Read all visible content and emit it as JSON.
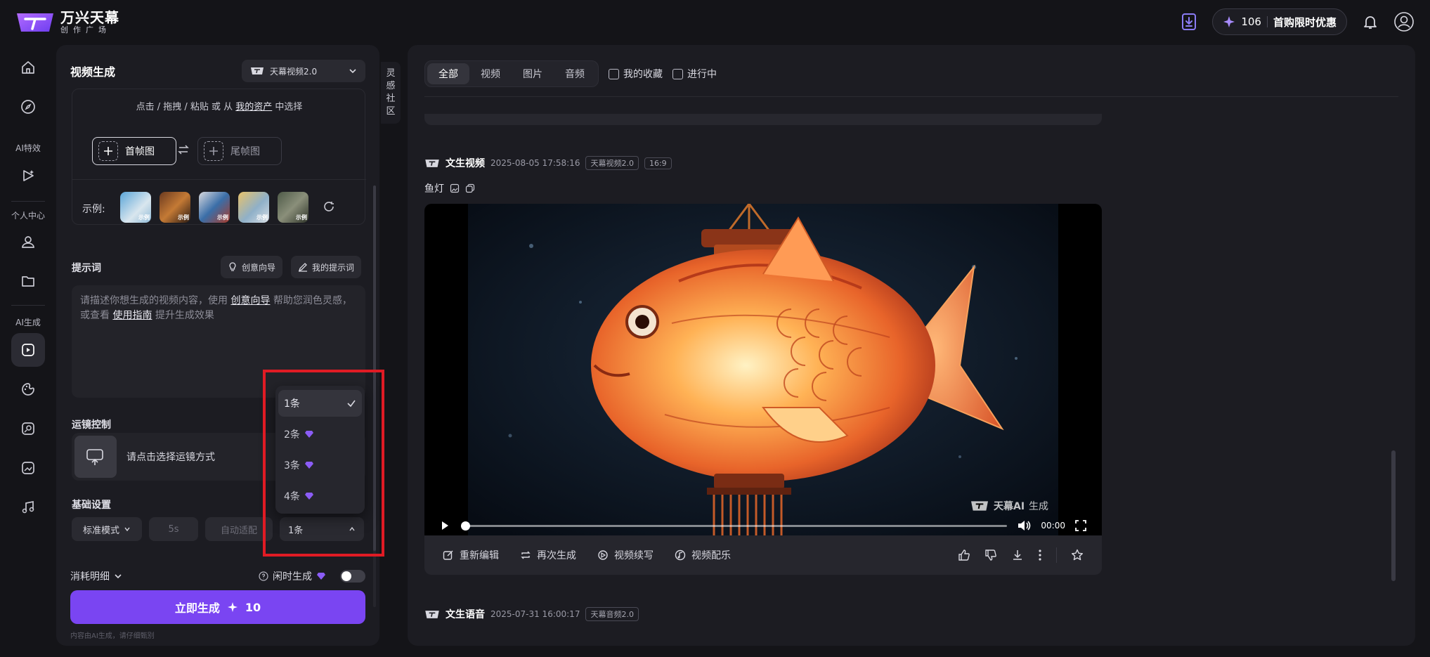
{
  "app": {
    "title": "万兴天幕",
    "subtitle": "创作广场"
  },
  "topbar": {
    "credits": "106",
    "promo": "首购限时优惠"
  },
  "rail": {
    "sections": [
      {
        "label": "AI特效"
      },
      {
        "label": "个人中心"
      },
      {
        "label": "AI生成"
      }
    ]
  },
  "panel": {
    "title": "视频生成",
    "model": "天幕视频2.0",
    "upload_hint_prefix": "点击 / 拖拽 / 粘贴  或 从 ",
    "upload_hint_link": "我的资产",
    "upload_hint_suffix": " 中选择",
    "first_frame": "首帧图",
    "last_frame": "尾帧图",
    "examples_label": "示例:",
    "example_tag": "示例",
    "prompt_label": "提示词",
    "creative_guide_btn": "创意向导",
    "my_prompts_btn": "我的提示词",
    "prompt_placeholder_1": "请描述你想生成的视频内容，使用 ",
    "prompt_placeholder_link1": "创意向导",
    "prompt_placeholder_2": " 帮助您润色灵感，",
    "prompt_placeholder_3": "或查看 ",
    "prompt_placeholder_link2": "使用指南",
    "prompt_placeholder_4": " 提升生成效果",
    "camera_label": "运镜控制",
    "camera_placeholder": "请点击选择运镜方式",
    "basic_label": "基础设置",
    "mode": "标准模式",
    "duration": "5s",
    "ratio": "自动适配",
    "count": "1条",
    "cost_detail": "消耗明细",
    "idle_generate": "闲时生成",
    "generate_label": "立即生成",
    "generate_cost": "10",
    "disclaimer": "内容由AI生成，请仔细甄别"
  },
  "dropdown": {
    "options": [
      {
        "label": "1条",
        "selected": true
      },
      {
        "label": "2条",
        "premium": true
      },
      {
        "label": "3条",
        "premium": true
      },
      {
        "label": "4条",
        "premium": true
      }
    ]
  },
  "inspiration_tab": [
    "灵",
    "感",
    "社",
    "区"
  ],
  "main": {
    "tabs": [
      "全部",
      "视频",
      "图片",
      "音频"
    ],
    "active_tab": "全部",
    "checks": [
      "我的收藏",
      "进行中"
    ],
    "item1": {
      "title": "文生视频",
      "time": "2025-08-05 17:58:16",
      "tags": [
        "天幕视频2.0",
        "16:9"
      ],
      "prompt": "鱼灯",
      "watermark_brand": "天幕AI",
      "watermark_suffix": "生成",
      "video_time": "00:00",
      "actions": [
        "重新编辑",
        "再次生成",
        "视频续写",
        "视频配乐"
      ]
    },
    "item2": {
      "title": "文生语音",
      "time": "2025-07-31 16:00:17",
      "tags": [
        "天幕音频2.0"
      ]
    }
  },
  "colors": {
    "accent": "#7a45f2",
    "highlight": "#e01b24",
    "premium": "#8b5cf6"
  }
}
